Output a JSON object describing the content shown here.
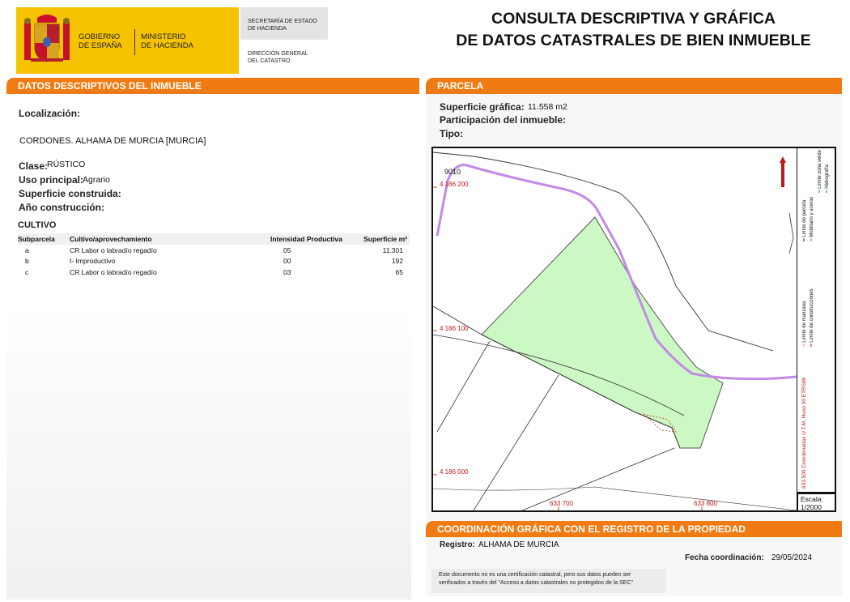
{
  "header": {
    "gobierno_lines": [
      "GOBIERNO",
      "DE ESPAÑA"
    ],
    "ministerio_lines": [
      "MINISTERIO",
      "DE HACIENDA"
    ],
    "secretaria_lines": [
      "SECRETARÍA DE ESTADO",
      "DE HACIENDA"
    ],
    "direccion_lines": [
      "DIRECCIÓN GENERAL",
      "DEL CATASTRO"
    ],
    "title_lines": [
      "CONSULTA DESCRIPTIVA Y GRÁFICA",
      "DE DATOS CATASTRALES DE BIEN INMUEBLE"
    ]
  },
  "descriptivos": {
    "heading": "DATOS DESCRIPTIVOS DEL INMUEBLE",
    "localizacion_label": "Localización:",
    "localizacion_value": "CORDONES. ALHAMA DE MURCIA [MURCIA]",
    "clase_label": "Clase:",
    "clase_value": "RÚSTICO",
    "uso_label": "Uso principal:",
    "uso_value": "Agrario",
    "superficie_label": "Superficie construida:",
    "anio_label": "Año construcción:"
  },
  "cultivo": {
    "heading": "CULTIVO",
    "columns": [
      "Subparcela",
      "Cultivo/aprovechamiento",
      "Intensidad Productiva",
      "Superficie m²"
    ],
    "rows": [
      [
        "a",
        "CR Labor o labradío regadío",
        "05",
        "11.301"
      ],
      [
        "b",
        "I- Improductivo",
        "00",
        "192"
      ],
      [
        "c",
        "CR Labor o labradío regadío",
        "03",
        "65"
      ]
    ]
  },
  "parcela": {
    "heading": "PARCELA",
    "superficie_label": "Superficie gráfica:",
    "superficie_value": "11.558 m2",
    "participacion_label": "Participación del inmueble:",
    "tipo_label": "Tipo:"
  },
  "map": {
    "parcel_number": "9010",
    "y_labels": [
      "4 186 200",
      "4 186 100",
      "4 186 000"
    ],
    "x_labels": [
      "633 700",
      "633 800"
    ],
    "legend_items": [
      "Límite de manzana",
      "Límite de parcela",
      "Límite de construcciones",
      "Mobiliario y aceras",
      "Límite zona verde",
      "Hidrografía"
    ],
    "coord_note": "633.500 Coordenadas U.T.M. Huso 30 ETRS89",
    "scale_label": "Escala:",
    "scale_value": "1/2000",
    "colors": {
      "parcel_fill": "#ccf8c4",
      "river": "#c28ae6",
      "coord_text": "#c01818"
    }
  },
  "coordinacion": {
    "heading": "COORDINACIÓN GRÁFICA CON EL REGISTRO DE LA PROPIEDAD",
    "registro_label": "Registro:",
    "registro_value": "ALHAMA DE MURCIA",
    "fecha_label": "Fecha coordinación:",
    "fecha_value": "29/05/2024",
    "note_lines": [
      "Este documento no es una certificación catastral, pero sus datos pueden ser",
      "verificados a través del \"Acceso a datos catastrales no protegidos de la SEC\""
    ]
  },
  "colors": {
    "band": "#f07b12",
    "logo_yellow": "#f6c300"
  }
}
